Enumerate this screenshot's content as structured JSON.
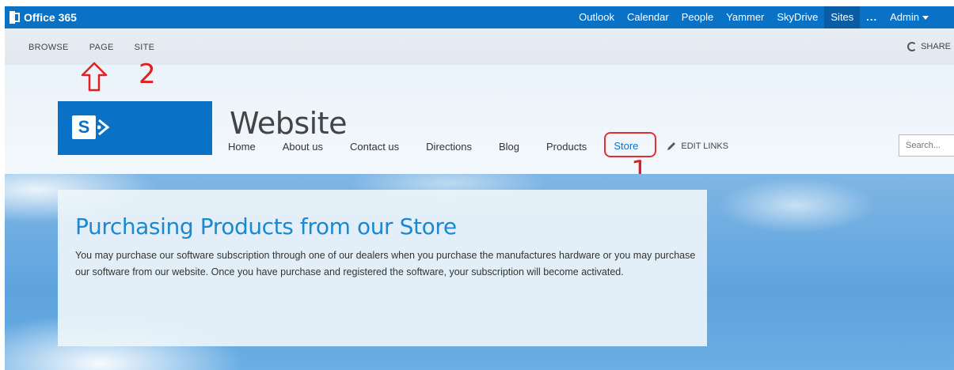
{
  "suitebar": {
    "brand": "Office 365",
    "links": [
      "Outlook",
      "Calendar",
      "People",
      "Yammer",
      "SkyDrive",
      "Sites",
      "...",
      "Admin"
    ],
    "active": "Sites",
    "colors": {
      "bar": "#0a72c6",
      "active": "#0a5da4"
    }
  },
  "ribbon": {
    "tabs": [
      "BROWSE",
      "PAGE",
      "SITE"
    ],
    "share_label": "SHARE"
  },
  "site": {
    "logo_icon": "sharepoint-logo",
    "title": "Website",
    "nav": [
      "Home",
      "About us",
      "Contact us",
      "Directions",
      "Blog",
      "Products",
      "Store"
    ],
    "edit_links": "EDIT LINKS",
    "search_placeholder": "Search..."
  },
  "annotations": {
    "label_1": "1",
    "label_2": "2"
  },
  "content": {
    "title": "Purchasing Products from our Store",
    "body": "You may purchase our software subscription through one of our dealers when you purchase the manufactures hardware or you may purchase our software from our website.    Once you have purchase and registered the software, your subscription will become activated."
  }
}
